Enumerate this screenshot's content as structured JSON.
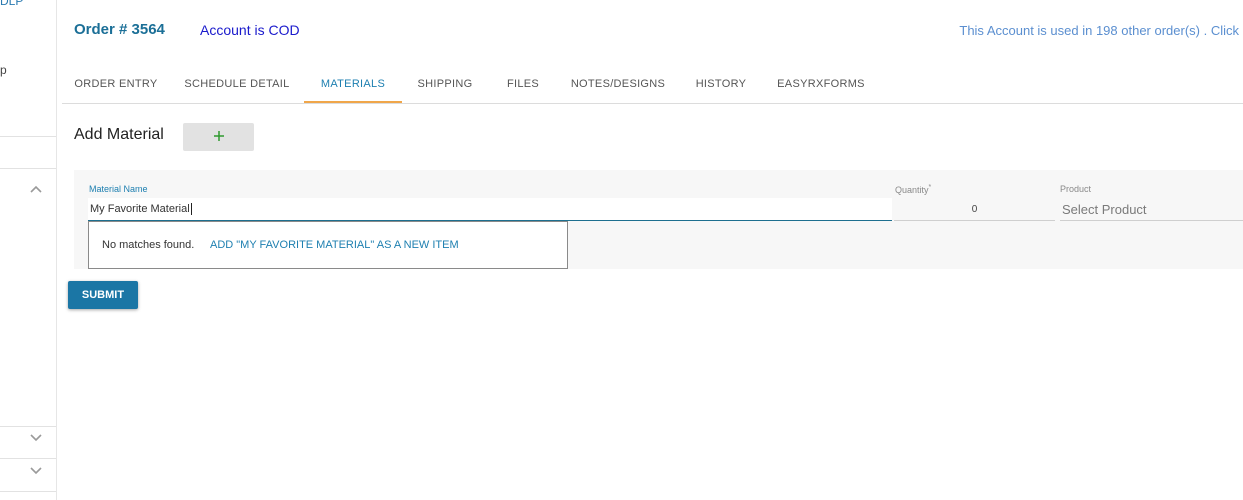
{
  "sidebar": {
    "top_fragment": "DLP",
    "mid_fragment": "p"
  },
  "header": {
    "order_title": "Order # 3564",
    "account_status": "Account is COD",
    "account_usage": "This Account is used in 198 other order(s) . Click"
  },
  "tabs": [
    {
      "label": "ORDER ENTRY",
      "active": false
    },
    {
      "label": "SCHEDULE DETAIL",
      "active": false
    },
    {
      "label": "MATERIALS",
      "active": true
    },
    {
      "label": "SHIPPING",
      "active": false
    },
    {
      "label": "FILES",
      "active": false
    },
    {
      "label": "NOTES/DESIGNS",
      "active": false
    },
    {
      "label": "HISTORY",
      "active": false
    },
    {
      "label": "EASYRXFORMS",
      "active": false
    }
  ],
  "materials": {
    "add_label": "Add Material",
    "add_button_icon": "plus-icon",
    "form": {
      "material_name_label": "Material Name",
      "material_name_value": "My Favorite Material",
      "quantity_label": "Quantity",
      "quantity_required_mark": "*",
      "quantity_value": "0",
      "product_label": "Product",
      "product_placeholder": "Select Product"
    },
    "dropdown": {
      "no_matches": "No matches found.",
      "add_new": "ADD \"MY FAVORITE MATERIAL\" AS A NEW ITEM"
    },
    "submit_label": "SUBMIT"
  },
  "colors": {
    "accent": "#1d7fb0",
    "tab_indicator": "#f0a64a",
    "submit_bg": "#1b76a5",
    "plus_icon": "#2e9a2e"
  }
}
